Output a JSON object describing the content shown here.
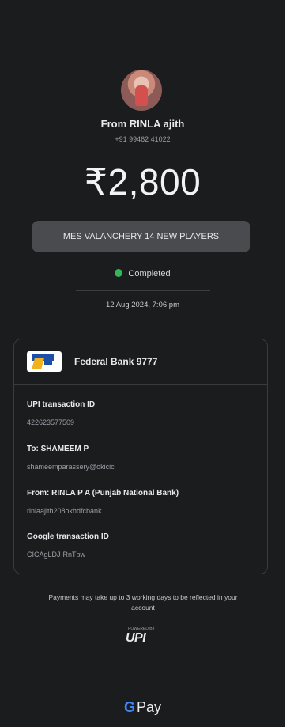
{
  "sender": {
    "name": "From RINLA ajith",
    "phone": "+91 99462 41022"
  },
  "payment": {
    "amount": "₹2,800",
    "note": "MES VALANCHERY 14 NEW PLAYERS",
    "status": "Completed",
    "datetime": "12 Aug 2024, 7:06 pm"
  },
  "card": {
    "bank": "Federal Bank 9777",
    "upi_txn_label": "UPI transaction ID",
    "upi_txn_value": "422623577509",
    "to_label": "To: SHAMEEM P",
    "to_value": "shameemparassery@okicici",
    "from_label": "From: RINLA P A (Punjab National Bank)",
    "from_value": "rinlaajith208okhdfcbank",
    "google_txn_label": "Google transaction ID",
    "google_txn_value": "CICAgLDJ-RnTbw"
  },
  "footer": {
    "disclaimer": "Payments may take up to 3 working days to be reflected in your account",
    "upi_small": "POWERED BY",
    "upi_big": "UPI",
    "gpay_g": "G",
    "gpay_text": "Pay"
  },
  "colors": {
    "background": "#1b1c1e",
    "note_bg": "#4a4b4e",
    "status_green": "#35b558",
    "card_border": "#3a3b3e"
  },
  "icons": [
    "profile-avatar",
    "check-status-dot",
    "federal-bank-logo",
    "upi-logo",
    "google-g-logo"
  ]
}
